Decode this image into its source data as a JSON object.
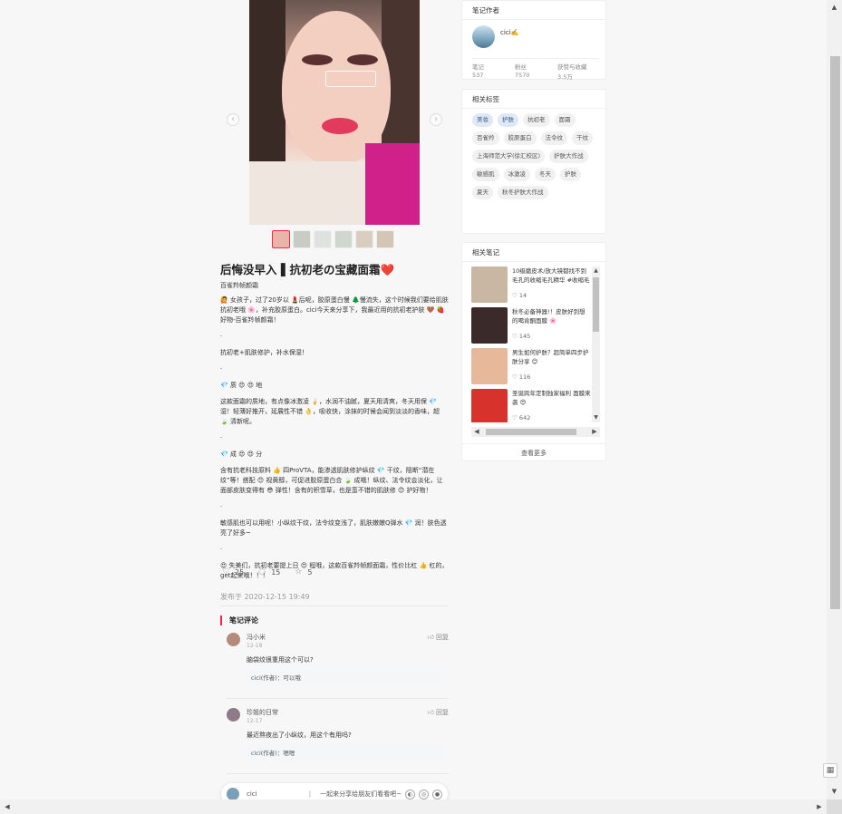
{
  "note": {
    "title": "后悔没早入 ▌抗初老の宝藏面霜❤️",
    "subtitle": "百雀羚帧颜霜",
    "body": [
      "🙋 女孩子，过了20岁以 💄后呢，胶原蛋白慢 🌲慢流失，这个时候我们要给肌肤抗初老哦 🌸，补充胶原蛋白。cici今天来分享下，我最近用的抗初老护肤 🤎 🍓 好物-百雀羚帧颜霜！",
      "·",
      "抗初老+肌肤修护，补水保湿！",
      "·",
      "💎 质 😍 😍 地",
      "这款面霜的质地，有点像冰激凌 🍦，水润不油腻，夏天用清爽，冬天用保 💎 湿！轻薄好推开，延展性不错 👌，吸收快，涂抹的时候会闻到淡淡的香味，超 🍃 清新呢。",
      "·",
      "💎 成 😍 😍 分",
      "含有抗老科技原料 👍 四ProVTA，能渗透肌肤修护纵纹 💎 干纹，阻断“潜在纹”等！搭配 😊 视黄醇，可促进胶原蛋白合 🍃 成哦！纵纹、法令纹会淡化，让面部皮肤变得有 😎 弹性！含有的积雪草，也是蛮不错的肌肤修 😊 护好物！",
      "·",
      "敏感肌也可以用呢！小纵纹干纹，法令纹变浅了，肌肤嫩嫩Q弹水 💎 润！肤色透亮了好多~",
      "·",
      "😍 失美们，抗初老要提上日 😍 程哦，这款百雀羚帧颜面霜，性价比杠 👍 杠的，get起来哦！！！"
    ],
    "likes": "25",
    "comments": "15",
    "stars": "5",
    "published": "发布于 2020-12-15 19:49",
    "comment_heading": "笔记评论",
    "comment_list": [
      {
        "name": "冯小米",
        "date": "12-18",
        "text": "脑袋纹很重用这个可以?",
        "reply_label": "回复",
        "sub": "cici(作者)：可以哦"
      },
      {
        "name": "珍姐的日常",
        "date": "12-17",
        "text": "最近熬夜出了小纵纹，用这个有用吗?",
        "reply_label": "回复",
        "sub": "cici(作者)：嗯嗯"
      }
    ]
  },
  "share_bar": {
    "name": "cici",
    "prompt": "一起来分享给朋友们看看吧~"
  },
  "author_card": {
    "heading": "笔记作者",
    "name": "cici✍️",
    "stats": [
      {
        "label": "笔记",
        "value": "537"
      },
      {
        "label": "粉丝",
        "value": "7570"
      },
      {
        "label": "获赞与收藏",
        "value": "3.5万"
      }
    ]
  },
  "tags_card": {
    "heading": "相关标签",
    "tags": [
      {
        "label": "美妆",
        "hl": true
      },
      {
        "label": "护肤",
        "hl": true
      },
      {
        "label": "抗初老",
        "hl": false
      },
      {
        "label": "面霜",
        "hl": false
      },
      {
        "label": "百雀羚",
        "hl": false
      },
      {
        "label": "胶原蛋白",
        "hl": false
      },
      {
        "label": "法令纹",
        "hl": false
      },
      {
        "label": "干纹",
        "hl": false
      },
      {
        "label": "上海师范大学(徐汇校区)",
        "hl": false
      },
      {
        "label": "护肤大作战",
        "hl": false
      },
      {
        "label": "敏感肌",
        "hl": false
      },
      {
        "label": "冰激凌",
        "hl": false
      },
      {
        "label": "冬天",
        "hl": false
      },
      {
        "label": "护肤",
        "hl": false
      },
      {
        "label": "夏天",
        "hl": false
      },
      {
        "label": "秋冬护肤大作战",
        "hl": false
      }
    ]
  },
  "related_card": {
    "heading": "相关笔记",
    "more_label": "查看更多",
    "items": [
      {
        "title": "10级磨皮术/放大镜都找不到毛孔的收缩毛孔精华 #收缩毛孔",
        "likes": "14",
        "color": "#c9b6a3"
      },
      {
        "title": "秋冬必备神器!！皮肤好到想的喝肯酮面膜 🌸",
        "likes": "145",
        "color": "#3a2a2a"
      },
      {
        "title": "男生如何护肤？超简单四步护肤分享 😊",
        "likes": "116",
        "color": "#e7b89a"
      },
      {
        "title": "圣诞跨年定制独家福利 面膜来袭 😍",
        "likes": "642",
        "color": "#d8322c"
      }
    ]
  }
}
